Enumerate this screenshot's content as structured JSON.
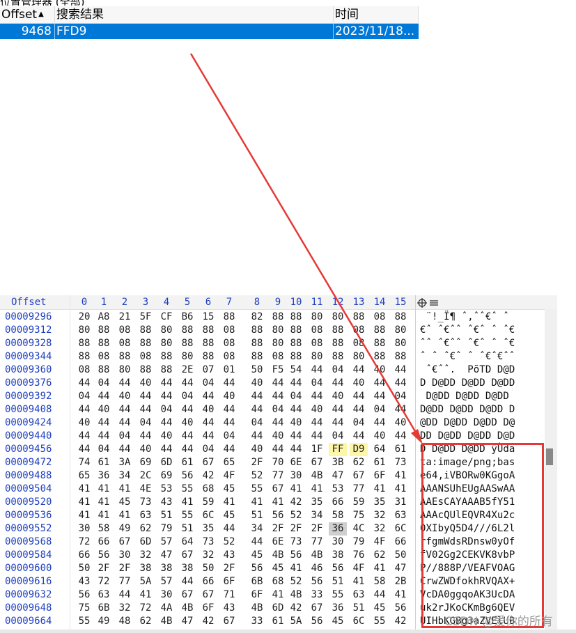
{
  "window": {
    "title": "位置管理器 (全部)"
  },
  "list": {
    "headers": {
      "offset": "Offset",
      "sort_arrow": "▲",
      "result": "搜索结果",
      "time": "时间"
    },
    "rows": [
      {
        "offset": "9468",
        "result": "FFD9",
        "time": "2023/11/18..."
      }
    ]
  },
  "hex": {
    "offset_header": "Offset",
    "columns": [
      "0",
      "1",
      "2",
      "3",
      "4",
      "5",
      "6",
      "7",
      "8",
      "9",
      "10",
      "11",
      "12",
      "13",
      "14",
      "15"
    ],
    "rows": [
      {
        "offset": "00009296",
        "bytes": [
          "20",
          "A8",
          "21",
          "5F",
          "CF",
          "B6",
          "15",
          "88",
          "82",
          "88",
          "88",
          "80",
          "80",
          "88",
          "08",
          "88"
        ],
        "text": " ¨!_Ï¶ ˆ‚ˆˆ€ˆ ˆ"
      },
      {
        "offset": "00009312",
        "bytes": [
          "80",
          "88",
          "08",
          "88",
          "80",
          "88",
          "88",
          "08",
          "88",
          "80",
          "88",
          "08",
          "88",
          "08",
          "88",
          "80"
        ],
        "text": "€ˆ ˆ€ˆˆ ˆ€ˆ ˆ ˆ€"
      },
      {
        "offset": "00009328",
        "bytes": [
          "88",
          "88",
          "08",
          "88",
          "80",
          "88",
          "88",
          "08",
          "88",
          "80",
          "88",
          "08",
          "88",
          "08",
          "88",
          "80"
        ],
        "text": "ˆˆ ˆ€ˆˆ ˆ€ˆ ˆ ˆ€"
      },
      {
        "offset": "00009344",
        "bytes": [
          "88",
          "08",
          "88",
          "08",
          "88",
          "80",
          "88",
          "08",
          "88",
          "08",
          "88",
          "80",
          "88",
          "80",
          "88",
          "88"
        ],
        "text": "ˆ ˆ ˆ€ˆ ˆ ˆ€ˆ€ˆˆ"
      },
      {
        "offset": "00009360",
        "bytes": [
          "08",
          "88",
          "80",
          "88",
          "88",
          "2E",
          "07",
          "01",
          "50",
          "F5",
          "54",
          "44",
          "04",
          "44",
          "40",
          "44"
        ],
        "text": " ˆ€ˆˆ.  PõTD D@D"
      },
      {
        "offset": "00009376",
        "bytes": [
          "44",
          "04",
          "44",
          "40",
          "44",
          "44",
          "04",
          "44",
          "40",
          "44",
          "44",
          "04",
          "44",
          "40",
          "44",
          "44"
        ],
        "text": "D D@DD D@DD D@DD"
      },
      {
        "offset": "00009392",
        "bytes": [
          "04",
          "44",
          "40",
          "44",
          "44",
          "04",
          "44",
          "40",
          "44",
          "44",
          "04",
          "44",
          "40",
          "44",
          "44",
          "04"
        ],
        "text": " D@DD D@DD D@DD "
      },
      {
        "offset": "00009408",
        "bytes": [
          "44",
          "40",
          "44",
          "44",
          "04",
          "44",
          "40",
          "44",
          "44",
          "04",
          "44",
          "40",
          "44",
          "44",
          "04",
          "44"
        ],
        "text": "D@DD D@DD D@DD D"
      },
      {
        "offset": "00009424",
        "bytes": [
          "40",
          "44",
          "44",
          "04",
          "44",
          "40",
          "44",
          "44",
          "04",
          "44",
          "40",
          "44",
          "44",
          "04",
          "44",
          "40"
        ],
        "text": "@DD D@DD D@DD D@"
      },
      {
        "offset": "00009440",
        "bytes": [
          "44",
          "44",
          "04",
          "44",
          "40",
          "44",
          "44",
          "04",
          "44",
          "40",
          "44",
          "44",
          "04",
          "44",
          "40",
          "44"
        ],
        "text": "DD D@DD D@DD D@D"
      },
      {
        "offset": "00009456",
        "bytes": [
          "44",
          "04",
          "44",
          "40",
          "44",
          "44",
          "04",
          "44",
          "40",
          "44",
          "44",
          "1F",
          "FF",
          "D9",
          "64",
          "61"
        ],
        "text": "D D@DD D@DD ÿÙda"
      },
      {
        "offset": "00009472",
        "bytes": [
          "74",
          "61",
          "3A",
          "69",
          "6D",
          "61",
          "67",
          "65",
          "2F",
          "70",
          "6E",
          "67",
          "3B",
          "62",
          "61",
          "73"
        ],
        "text": "ta:image/png;bas"
      },
      {
        "offset": "00009488",
        "bytes": [
          "65",
          "36",
          "34",
          "2C",
          "69",
          "56",
          "42",
          "4F",
          "52",
          "77",
          "30",
          "4B",
          "47",
          "67",
          "6F",
          "41"
        ],
        "text": "e64,iVBORw0KGgoA"
      },
      {
        "offset": "00009504",
        "bytes": [
          "41",
          "41",
          "41",
          "4E",
          "53",
          "55",
          "68",
          "45",
          "55",
          "67",
          "41",
          "41",
          "53",
          "77",
          "41",
          "41"
        ],
        "text": "AAANSUhEUgAASwAA"
      },
      {
        "offset": "00009520",
        "bytes": [
          "41",
          "41",
          "45",
          "73",
          "43",
          "41",
          "59",
          "41",
          "41",
          "41",
          "42",
          "35",
          "66",
          "59",
          "35",
          "31"
        ],
        "text": "AAEsCAYAAAB5fY51"
      },
      {
        "offset": "00009536",
        "bytes": [
          "41",
          "41",
          "41",
          "63",
          "51",
          "55",
          "6C",
          "45",
          "51",
          "56",
          "52",
          "34",
          "58",
          "75",
          "32",
          "63"
        ],
        "text": "AAAcQUlEQVR4Xu2c"
      },
      {
        "offset": "00009552",
        "bytes": [
          "30",
          "58",
          "49",
          "62",
          "79",
          "51",
          "35",
          "44",
          "34",
          "2F",
          "2F",
          "2F",
          "36",
          "4C",
          "32",
          "6C"
        ],
        "text": "0XIbyQ5D4///6L2l"
      },
      {
        "offset": "00009568",
        "bytes": [
          "72",
          "66",
          "67",
          "6D",
          "57",
          "64",
          "73",
          "52",
          "44",
          "6E",
          "73",
          "77",
          "30",
          "79",
          "4F",
          "66"
        ],
        "text": "rfgmWdsRDnsw0yOf"
      },
      {
        "offset": "00009584",
        "bytes": [
          "66",
          "56",
          "30",
          "32",
          "47",
          "67",
          "32",
          "43",
          "45",
          "4B",
          "56",
          "4B",
          "38",
          "76",
          "62",
          "50"
        ],
        "text": "fV02Gg2CEKVK8vbP"
      },
      {
        "offset": "00009600",
        "bytes": [
          "50",
          "2F",
          "2F",
          "38",
          "38",
          "38",
          "50",
          "2F",
          "56",
          "45",
          "41",
          "46",
          "56",
          "4F",
          "41",
          "47"
        ],
        "text": "P//888P/VEAFVOAG"
      },
      {
        "offset": "00009616",
        "bytes": [
          "43",
          "72",
          "77",
          "5A",
          "57",
          "44",
          "66",
          "6F",
          "6B",
          "68",
          "52",
          "56",
          "51",
          "41",
          "58",
          "2B"
        ],
        "text": "CrwZWDfokhRVQAX+"
      },
      {
        "offset": "00009632",
        "bytes": [
          "56",
          "63",
          "44",
          "41",
          "30",
          "67",
          "67",
          "71",
          "6F",
          "41",
          "4B",
          "33",
          "55",
          "63",
          "44",
          "41"
        ],
        "text": "VcDA0ggqoAK3UcDA"
      },
      {
        "offset": "00009648",
        "bytes": [
          "75",
          "6B",
          "32",
          "72",
          "4A",
          "4B",
          "6F",
          "43",
          "4B",
          "6D",
          "42",
          "67",
          "36",
          "51",
          "45",
          "56"
        ],
        "text": "uk2rJKoCKmBg6QEV"
      },
      {
        "offset": "00009664",
        "bytes": [
          "55",
          "49",
          "48",
          "62",
          "4B",
          "47",
          "42",
          "67",
          "33",
          "61",
          "5A",
          "56",
          "45",
          "6C",
          "55",
          "42"
        ],
        "text": "UIHbKGBg3aZVElUB"
      }
    ]
  },
  "watermark": "CSDN @爱你的所有",
  "colors": {
    "selection": "#0078d7",
    "offset_text": "#1e3fbf",
    "highlight_ffd9": "#fff7a8",
    "annotation": "#e53935"
  }
}
